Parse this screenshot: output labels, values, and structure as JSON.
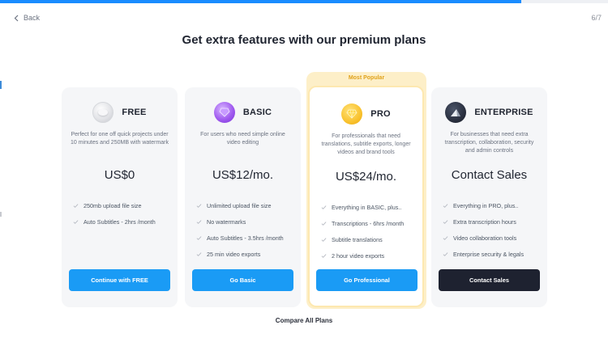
{
  "header": {
    "back_label": "Back",
    "step": "6/7",
    "progress_fraction": 0.857
  },
  "headline": "Get extra features with our premium plans",
  "popular_label": "Most Popular",
  "plans": [
    {
      "name": "FREE",
      "description": "Perfect for one off quick projects under 10 minutes and 250MB with watermark",
      "price": "US$0",
      "features": [
        "250mb upload file size",
        "Auto Subtitles - 2hrs /month"
      ],
      "cta": "Continue with FREE"
    },
    {
      "name": "BASIC",
      "description": "For users who need simple online video editing",
      "price": "US$12/mo.",
      "features": [
        "Unlimited upload file size",
        "No watermarks",
        "Auto Subtitles - 3.5hrs /month",
        "25 min video exports"
      ],
      "cta": "Go Basic"
    },
    {
      "name": "PRO",
      "description": "For professionals that need translations, subtitle exports, longer videos and brand tools",
      "price": "US$24/mo.",
      "features": [
        "Everything in BASIC, plus..",
        "Transcriptions - 6hrs /month",
        "Subtitle translations",
        "2 hour video exports"
      ],
      "cta": "Go Professional"
    },
    {
      "name": "ENTERPRISE",
      "description": "For businesses that need extra transcription, collaboration, security and admin controls",
      "price": "Contact Sales",
      "features": [
        "Everything in PRO, plus..",
        "Extra transcription hours",
        "Video collaboration tools",
        "Enterprise security & legals"
      ],
      "cta": "Contact Sales"
    }
  ],
  "compare_label": "Compare All Plans",
  "colors": {
    "primary": "#1a9bf5",
    "dark_cta": "#1e2230",
    "popular": "#fdefc8",
    "popular_text": "#e0a21b"
  },
  "icons": [
    "chevron-left-icon",
    "free-plan-orb-icon",
    "basic-plan-gem-icon",
    "pro-plan-diamond-icon",
    "enterprise-plan-peak-icon",
    "check-icon"
  ]
}
